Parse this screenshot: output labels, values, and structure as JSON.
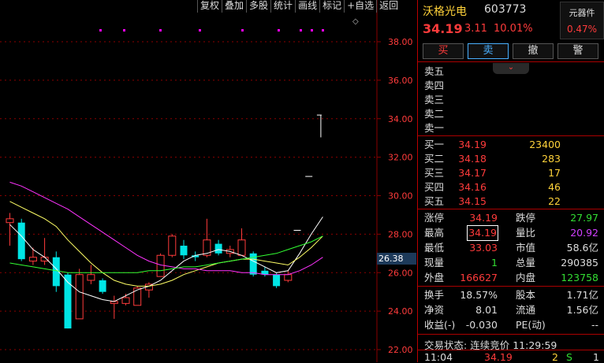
{
  "toolbar": {
    "items": [
      "复权",
      "叠加",
      "多股",
      "统计",
      "画线",
      "标记",
      "+自选",
      "返回"
    ]
  },
  "chart": {
    "y_ticks": [
      "38.00",
      "36.00",
      "34.00",
      "32.00",
      "30.00",
      "28.00",
      "26.00",
      "24.00",
      "22.00"
    ],
    "current_price_tag": "26.38",
    "colors": {
      "up": "#ff3b3b",
      "down": "#00e5e5",
      "ma5": "#ffffff",
      "ma10": "#ffff66",
      "ma20": "#ff33ff",
      "ma60": "#33ff33",
      "grid": "#8b0000",
      "tick": "#ff3b3b"
    }
  },
  "chart_data": {
    "type": "candlestick",
    "ylim": [
      21.5,
      39.6
    ],
    "candles": [
      {
        "o": 28.6,
        "h": 29.1,
        "l": 27.4,
        "c": 28.8
      },
      {
        "o": 28.6,
        "h": 28.8,
        "l": 26.6,
        "c": 26.7
      },
      {
        "o": 26.6,
        "h": 27.3,
        "l": 26.4,
        "c": 26.8
      },
      {
        "o": 26.6,
        "h": 27.8,
        "l": 26.4,
        "c": 26.8
      },
      {
        "o": 26.8,
        "h": 27.1,
        "l": 25.0,
        "c": 25.3
      },
      {
        "o": 25.9,
        "h": 26.0,
        "l": 23.1,
        "c": 23.1
      },
      {
        "o": 23.6,
        "h": 26.2,
        "l": 23.6,
        "c": 25.9
      },
      {
        "o": 25.6,
        "h": 26.4,
        "l": 25.4,
        "c": 25.9
      },
      {
        "o": 25.6,
        "h": 25.7,
        "l": 24.9,
        "c": 25.0
      },
      {
        "o": 24.4,
        "h": 24.8,
        "l": 23.6,
        "c": 24.5
      },
      {
        "o": 24.4,
        "h": 24.9,
        "l": 24.3,
        "c": 24.7
      },
      {
        "o": 24.3,
        "h": 25.3,
        "l": 24.3,
        "c": 25.2
      },
      {
        "o": 25.1,
        "h": 25.5,
        "l": 24.7,
        "c": 25.4
      },
      {
        "o": 25.8,
        "h": 27.0,
        "l": 25.8,
        "c": 26.9
      },
      {
        "o": 26.9,
        "h": 28.0,
        "l": 26.8,
        "c": 27.9
      },
      {
        "o": 27.4,
        "h": 27.7,
        "l": 26.7,
        "c": 26.9
      },
      {
        "o": 26.9,
        "h": 27.1,
        "l": 26.6,
        "c": 26.8
      },
      {
        "o": 26.9,
        "h": 28.8,
        "l": 26.8,
        "c": 27.7
      },
      {
        "o": 27.5,
        "h": 27.7,
        "l": 26.9,
        "c": 27.0
      },
      {
        "o": 27.0,
        "h": 27.4,
        "l": 26.8,
        "c": 27.2
      },
      {
        "o": 26.9,
        "h": 28.3,
        "l": 26.9,
        "c": 27.7
      },
      {
        "o": 27.0,
        "h": 27.1,
        "l": 25.8,
        "c": 25.9
      },
      {
        "o": 26.1,
        "h": 26.3,
        "l": 25.8,
        "c": 25.9
      },
      {
        "o": 25.9,
        "h": 26.0,
        "l": 25.2,
        "c": 25.3
      },
      {
        "o": 25.6,
        "h": 26.1,
        "l": 25.5,
        "c": 25.9
      },
      {
        "o": 28.2,
        "h": 28.2,
        "l": 28.2,
        "c": 28.2
      },
      {
        "o": 31.0,
        "h": 31.0,
        "l": 31.0,
        "c": 31.0
      },
      {
        "o": 34.1,
        "h": 34.19,
        "l": 33.03,
        "c": 34.19
      }
    ],
    "ma_lines": {
      "ma5": [
        28.5,
        27.9,
        27.2,
        26.8,
        26.2,
        25.5,
        25.0,
        24.8,
        24.6,
        24.5,
        24.8,
        25.1,
        25.3,
        25.6,
        26.1,
        26.6,
        26.9,
        27.0,
        27.2,
        27.1,
        26.9,
        26.6,
        26.3,
        26.0,
        26.1,
        27.0,
        28.0,
        28.9
      ],
      "ma10": [
        29.7,
        29.4,
        29.1,
        28.8,
        28.4,
        27.7,
        27.1,
        26.5,
        26.0,
        25.6,
        25.4,
        25.3,
        25.3,
        25.4,
        25.6,
        25.9,
        26.1,
        26.3,
        26.5,
        26.6,
        26.7,
        26.7,
        26.6,
        26.5,
        26.4,
        26.8,
        27.3,
        27.9
      ],
      "ma20": [
        30.7,
        30.5,
        30.2,
        29.9,
        29.6,
        29.3,
        28.9,
        28.5,
        28.1,
        27.7,
        27.3,
        26.9,
        26.6,
        26.4,
        26.3,
        26.2,
        26.2,
        26.1,
        26.1,
        26.1,
        26.0,
        26.0,
        25.9,
        25.9,
        25.9,
        26.1,
        26.4,
        26.8
      ],
      "ma60": [
        26.5,
        26.4,
        26.3,
        26.2,
        26.1,
        26.0,
        26.0,
        26.0,
        26.0,
        26.0,
        26.0,
        26.0,
        26.1,
        26.1,
        26.2,
        26.3,
        26.3,
        26.4,
        26.5,
        26.6,
        26.7,
        26.8,
        26.9,
        27.0,
        27.2,
        27.4,
        27.6,
        27.9
      ]
    }
  },
  "stock": {
    "name": "沃格光电",
    "code": "603773",
    "price": "34.19",
    "change": "3.11",
    "change_pct": "10.01%",
    "sector": {
      "name": "元器件",
      "pct": "0.47%"
    }
  },
  "actions": [
    "买",
    "卖",
    "撤",
    "警"
  ],
  "asks": [
    {
      "label": "卖五",
      "price": "",
      "vol": ""
    },
    {
      "label": "卖四",
      "price": "",
      "vol": ""
    },
    {
      "label": "卖三",
      "price": "",
      "vol": ""
    },
    {
      "label": "卖二",
      "price": "",
      "vol": ""
    },
    {
      "label": "卖一",
      "price": "",
      "vol": ""
    }
  ],
  "bids": [
    {
      "label": "买一",
      "price": "34.19",
      "vol": "23400"
    },
    {
      "label": "买二",
      "price": "34.18",
      "vol": "283"
    },
    {
      "label": "买三",
      "price": "34.17",
      "vol": "17"
    },
    {
      "label": "买四",
      "price": "34.16",
      "vol": "46"
    },
    {
      "label": "买五",
      "price": "34.15",
      "vol": "22"
    }
  ],
  "quote": [
    {
      "l1": "涨停",
      "v1": "34.19",
      "c1": "red",
      "l2": "跌停",
      "v2": "27.97",
      "c2": "green"
    },
    {
      "l1": "最高",
      "v1": "34.19",
      "c1": "red",
      "l2": "量比",
      "v2": "20.92",
      "c2": "purple"
    },
    {
      "l1": "最低",
      "v1": "33.03",
      "c1": "red",
      "l2": "市值",
      "v2": "58.6亿",
      "c2": "white"
    },
    {
      "l1": "现量",
      "v1": "1",
      "c1": "green",
      "l2": "总量",
      "v2": "290385",
      "c2": "white"
    },
    {
      "l1": "外盘",
      "v1": "166627",
      "c1": "red",
      "l2": "内盘",
      "v2": "123758",
      "c2": "green"
    }
  ],
  "fundamentals": [
    {
      "l1": "换手",
      "v1": "18.57%",
      "l2": "股本",
      "v2": "1.71亿"
    },
    {
      "l1": "净资",
      "v1": "8.01",
      "l2": "流通",
      "v2": "1.56亿"
    },
    {
      "l1": "收益(-)",
      "v1": "-0.030",
      "l2": "PE(动)",
      "v2": "--"
    }
  ],
  "status": {
    "label": "交易状态:",
    "value": "连续竞价",
    "time": "11:29:59"
  },
  "last_tick": {
    "time": "11:04",
    "price": "34.19",
    "vol": "2",
    "side": "S",
    "count": "1"
  }
}
